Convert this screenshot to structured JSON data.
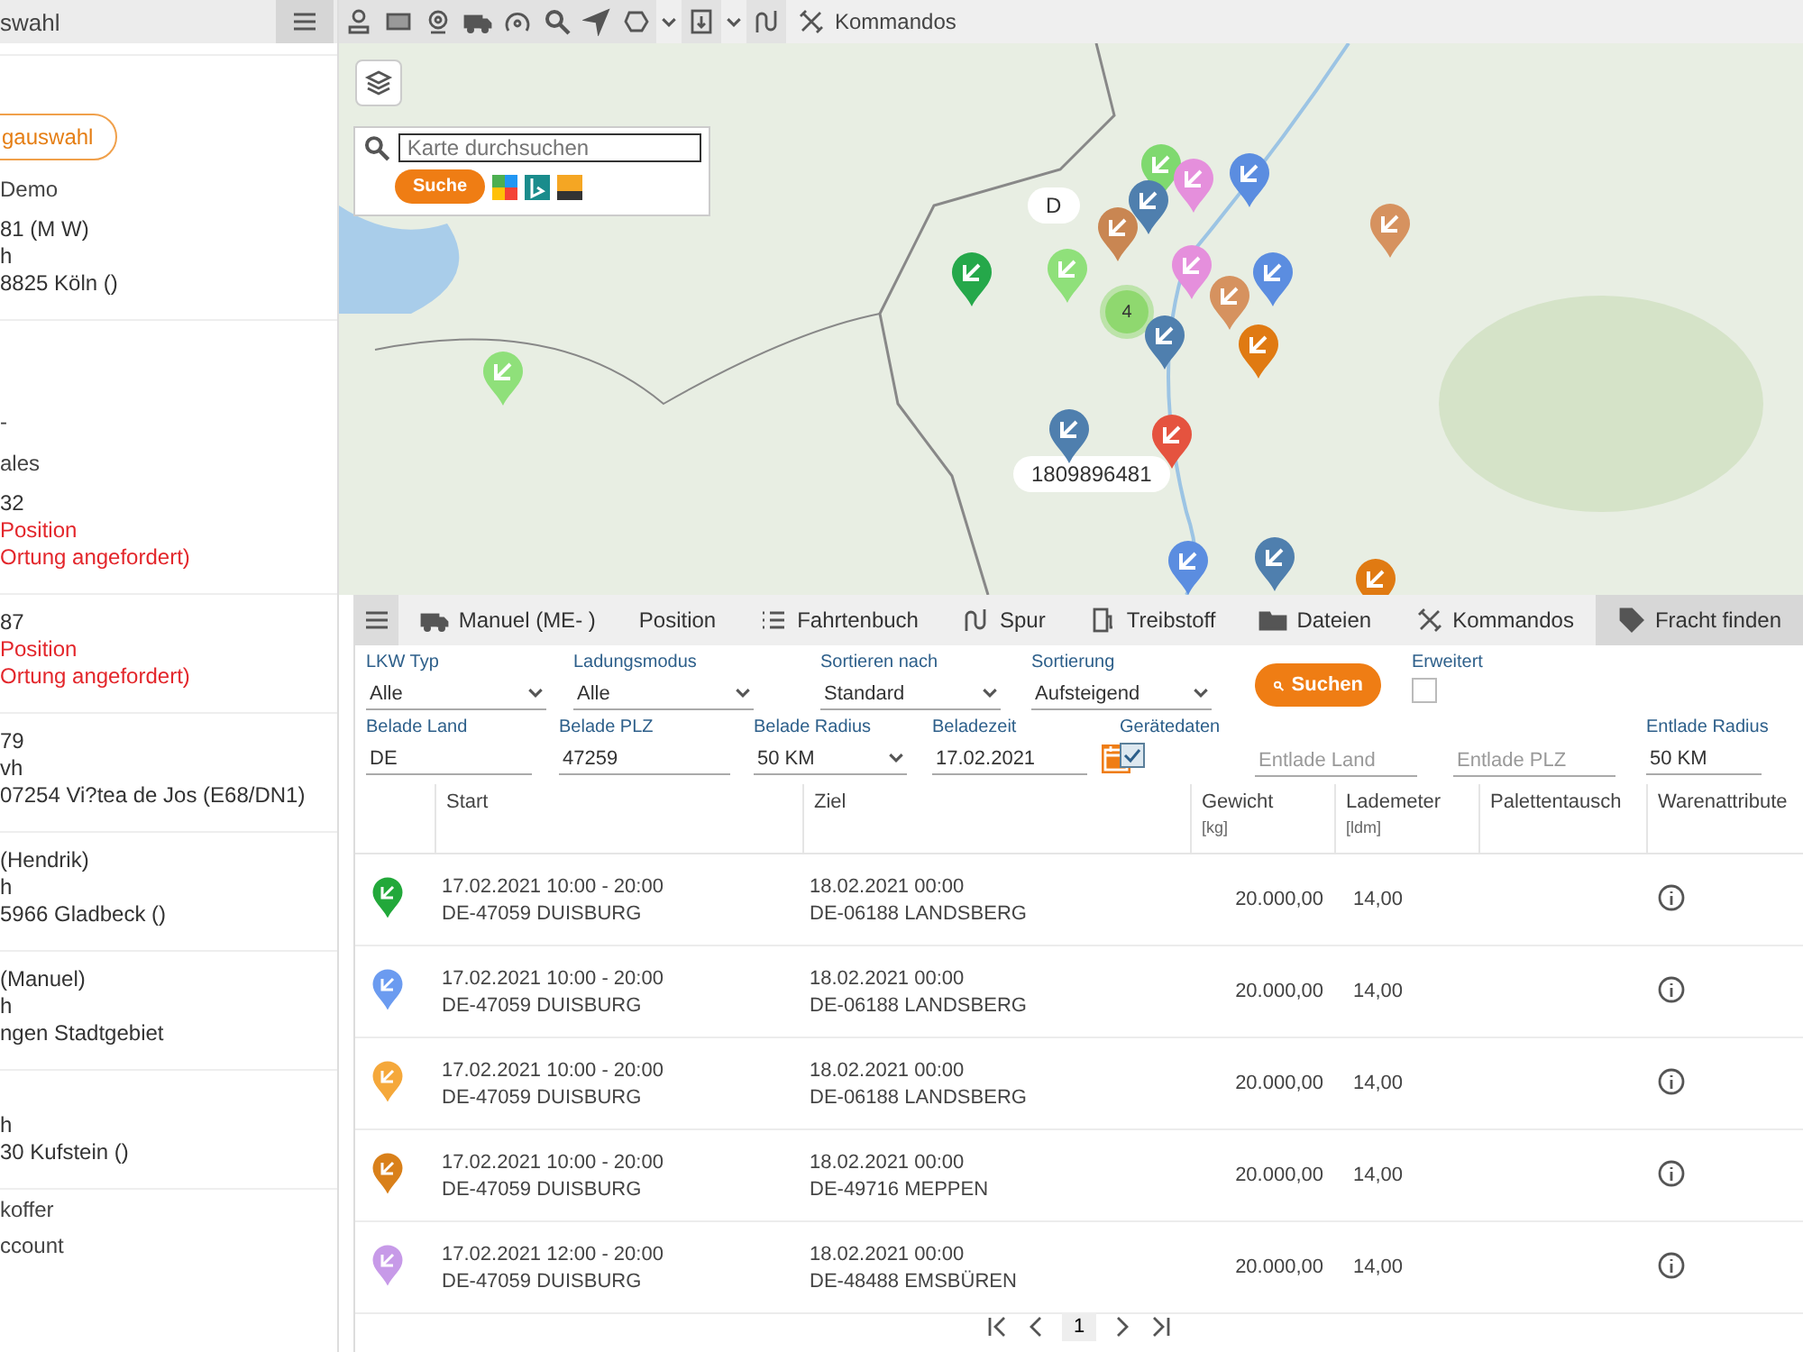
{
  "sidebar": {
    "title": "swahl",
    "group_button": "gauswahl",
    "items": [
      {
        "kind": "group",
        "label": "Demo"
      },
      {
        "kind": "vehicle",
        "lines": [
          "81 (M W)",
          "h",
          "8825 Köln ()"
        ],
        "alert": false
      },
      {
        "kind": "group",
        "label": "-"
      },
      {
        "kind": "group",
        "label": "ales"
      },
      {
        "kind": "vehicle",
        "lines": [
          "32",
          "Position",
          "Ortung angefordert)"
        ],
        "alert": true
      },
      {
        "kind": "vehicle",
        "lines": [
          "87",
          "Position",
          "Ortung angefordert)"
        ],
        "alert": true
      },
      {
        "kind": "vehicle",
        "lines": [
          "79",
          "vh",
          "07254 Vi?tea de Jos (E68/DN1)"
        ],
        "alert": false
      },
      {
        "kind": "vehicle",
        "lines": [
          "(Hendrik)",
          "h",
          "5966 Gladbeck ()"
        ],
        "alert": false
      },
      {
        "kind": "vehicle",
        "lines": [
          "(Manuel)",
          "h",
          "ngen Stadtgebiet"
        ],
        "alert": false
      },
      {
        "kind": "vehicle",
        "lines": [
          "h",
          "30 Kufstein ()"
        ],
        "alert": false
      },
      {
        "kind": "link",
        "label": "koffer"
      },
      {
        "kind": "link",
        "label": "ccount"
      }
    ]
  },
  "toolbar": {
    "items": [
      {
        "kind": "person"
      },
      {
        "kind": "card"
      },
      {
        "kind": "webcam"
      },
      {
        "kind": "truck"
      },
      {
        "kind": "route"
      },
      {
        "kind": "search"
      },
      {
        "kind": "navigate"
      },
      {
        "kind": "polygon"
      },
      {
        "kind": "caret"
      },
      {
        "kind": "download"
      },
      {
        "kind": "caret"
      },
      {
        "kind": "track"
      }
    ],
    "commands": "Kommandos"
  },
  "map": {
    "search_placeholder": "Karte durchsuchen",
    "search_button": "Suche",
    "cluster": "4",
    "labels": [
      "D",
      "1809896481"
    ],
    "markers": [
      {
        "color": "#7fd96f"
      },
      {
        "color": "#e58fdc"
      },
      {
        "color": "#5b8de0"
      },
      {
        "color": "#c98652"
      },
      {
        "color": "#4f7fae"
      },
      {
        "color": "#25a84a"
      },
      {
        "color": "#8fe07a"
      },
      {
        "color": "#e58fdc"
      },
      {
        "color": "#5b8de0"
      },
      {
        "color": "#d6925f"
      },
      {
        "color": "#4f7fae"
      },
      {
        "color": "#e07a12"
      },
      {
        "color": "#d6925f"
      },
      {
        "color": "#8fe07a"
      },
      {
        "color": "#4f7fae"
      },
      {
        "color": "#e5533f"
      },
      {
        "color": "#5b8de0"
      },
      {
        "color": "#4f7fae"
      },
      {
        "color": "#e07a12"
      }
    ]
  },
  "panel": {
    "vehicle": "Manuel (ME- )",
    "tabs": [
      {
        "label": "Position",
        "selected": false
      },
      {
        "label": "Fahrtenbuch",
        "selected": false
      },
      {
        "label": "Spur",
        "selected": false
      },
      {
        "label": "Treibstoff",
        "selected": false
      },
      {
        "label": "Dateien",
        "selected": false
      },
      {
        "label": "Kommandos",
        "selected": false
      },
      {
        "label": "Fracht finden",
        "selected": true
      }
    ]
  },
  "filters": [
    [
      {
        "kind": "select",
        "label": "LKW Typ",
        "value": "Alle"
      },
      {
        "kind": "select",
        "label": "Ladungsmodus",
        "value": "Alle"
      },
      {
        "kind": "select",
        "label": "Sortieren nach",
        "value": "Standard"
      },
      {
        "kind": "select",
        "label": "Sortierung",
        "value": "Aufsteigend"
      },
      {
        "kind": "button",
        "label": "Suchen"
      },
      {
        "kind": "checkbox",
        "label": "Erweitert",
        "checked": false
      }
    ],
    [
      {
        "kind": "text",
        "label": "Belade Land",
        "value": "DE"
      },
      {
        "kind": "text",
        "label": "Belade PLZ",
        "value": "47259"
      },
      {
        "kind": "select",
        "label": "Belade Radius",
        "value": "50 KM"
      },
      {
        "kind": "date",
        "label": "Beladezeit",
        "value": "17.02.2021"
      },
      {
        "kind": "checkbox",
        "label": "Gerätedaten",
        "checked": true
      },
      {
        "kind": "text",
        "placeholder": "Entlade Land"
      },
      {
        "kind": "text",
        "placeholder": "Entlade PLZ"
      },
      {
        "kind": "text",
        "label": "Entlade Radius",
        "value": "50 KM"
      }
    ]
  ],
  "table": {
    "columns": [
      {
        "title": "Start"
      },
      {
        "title": "Ziel"
      },
      {
        "title": "Gewicht",
        "unit": "[kg]"
      },
      {
        "title": "Lademeter",
        "unit": "[ldm]"
      },
      {
        "title": "Palettentausch"
      },
      {
        "title": "Warenattribute"
      }
    ],
    "rows": [
      {
        "color": "#22a83a",
        "start_time": "17.02.2021 10:00 - 20:00",
        "start_place": "DE-47059 DUISBURG",
        "end_time": "18.02.2021 00:00",
        "end_place": "DE-06188 LANDSBERG",
        "weight": "20.000,00",
        "ldm": "14,00"
      },
      {
        "color": "#6b9bf0",
        "start_time": "17.02.2021 10:00 - 20:00",
        "start_place": "DE-47059 DUISBURG",
        "end_time": "18.02.2021 00:00",
        "end_place": "DE-06188 LANDSBERG",
        "weight": "20.000,00",
        "ldm": "14,00"
      },
      {
        "color": "#f5a83a",
        "start_time": "17.02.2021 10:00 - 20:00",
        "start_place": "DE-47059 DUISBURG",
        "end_time": "18.02.2021 00:00",
        "end_place": "DE-06188 LANDSBERG",
        "weight": "20.000,00",
        "ldm": "14,00"
      },
      {
        "color": "#d9801a",
        "start_time": "17.02.2021 10:00 - 20:00",
        "start_place": "DE-47059 DUISBURG",
        "end_time": "18.02.2021 00:00",
        "end_place": "DE-49716 MEPPEN",
        "weight": "20.000,00",
        "ldm": "14,00"
      },
      {
        "color": "#c79ae8",
        "start_time": "17.02.2021 12:00 - 20:00",
        "start_place": "DE-47059 DUISBURG",
        "end_time": "18.02.2021 00:00",
        "end_place": "DE-48488 EMSBÜREN",
        "weight": "20.000,00",
        "ldm": "14,00"
      }
    ]
  },
  "pagination": {
    "page": "1"
  }
}
